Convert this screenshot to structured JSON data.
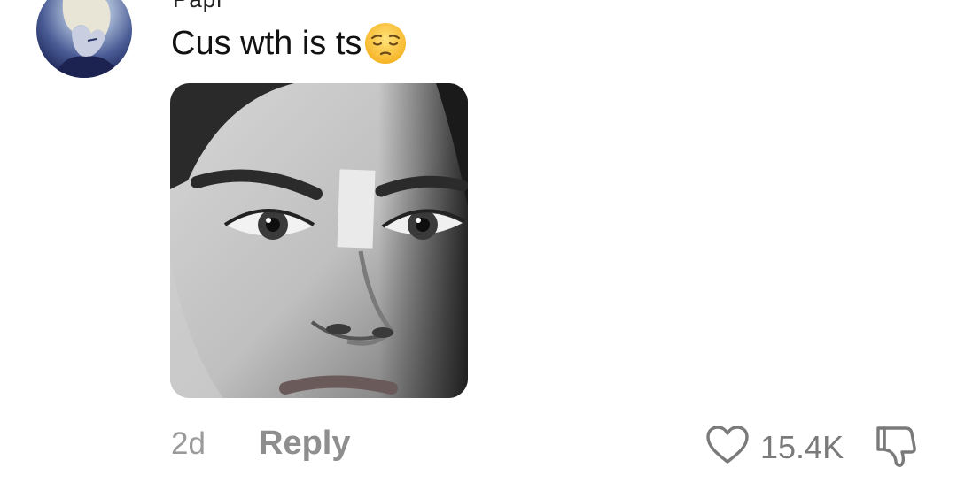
{
  "comment": {
    "username_partial": "Papi",
    "text": "Cus wth is ts",
    "emoji": "pensive-face-emoji",
    "attachment": "photo of a man's face with a strip of tape between the eyebrows",
    "time": "2d",
    "reply_label": "Reply",
    "like_count": "15.4K"
  },
  "colors": {
    "text": "#111111",
    "meta": "#9a9a9a",
    "icon": "#7a7a7a"
  }
}
